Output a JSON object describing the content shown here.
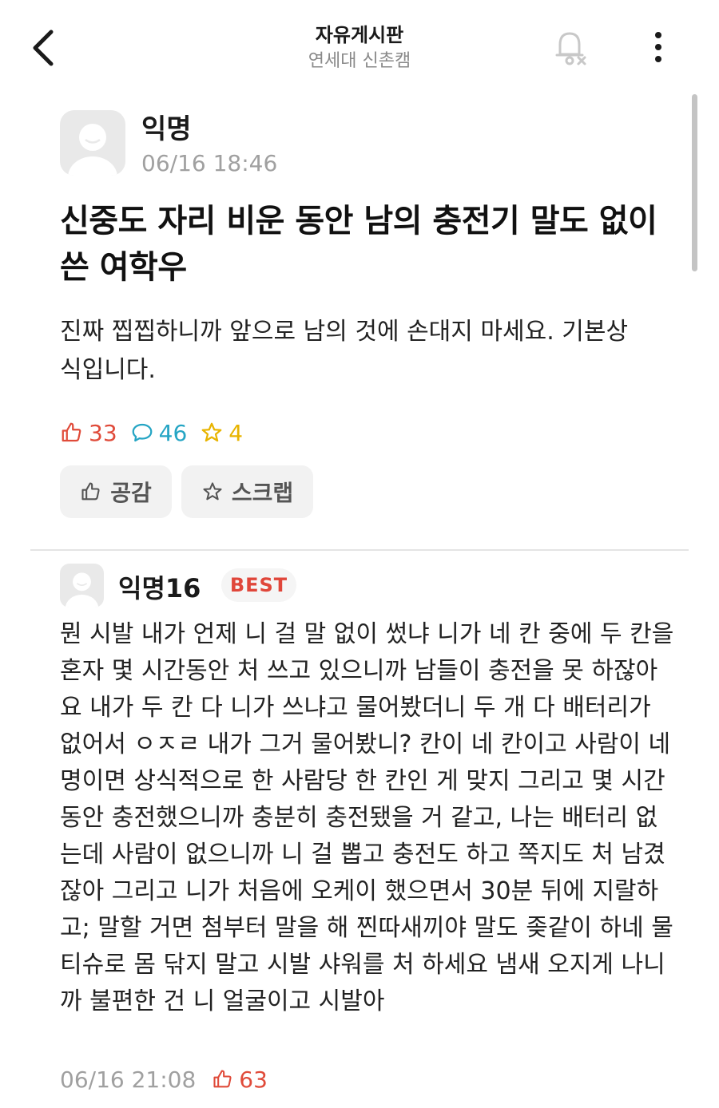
{
  "header": {
    "board_title": "자유게시판",
    "board_subtitle": "연세대 신촌캠"
  },
  "post": {
    "author": "익명",
    "time": "06/16 18:46",
    "title": "신중도 자리 비운 동안 남의 충전기 말도 없이 쓴 여학우",
    "body": "진짜 찝찝하니까 앞으로 남의 것에 손대지 마세요. 기본상식입니다.",
    "likes": "33",
    "comments": "46",
    "scraps": "4",
    "like_button": "공감",
    "scrap_button": "스크랩"
  },
  "comment": {
    "author": "익명16",
    "badge": "BEST",
    "body": "뭔 시발 내가 언제 니 걸 말 없이 썼냐 니가 네 칸 중에 두 칸을 혼자 몇 시간동안 처 쓰고 있으니까 남들이 충전을 못 하잖아요 내가 두 칸 다 니가 쓰냐고 물어봤더니 두 개 다 배터리가 없어서 ㅇㅈㄹ 내가 그거 물어봤니? 칸이 네 칸이고 사람이 네 명이면 상식적으로 한 사람당 한 칸인 게 맞지 그리고 몇 시간동안 충전했으니까 충분히 충전됐을 거 같고, 나는 배터리 없는데 사람이 없으니까 니 걸 뽑고 충전도 하고 쪽지도 처 남겼잖아 그리고 니가 처음에 오케이 했으면서 30분 뒤에 지랄하고; 말할 거면 첨부터 말을 해 찐따새끼야 말도 좆같이 하네 물티슈로 몸 닦지 말고 시발 샤워를 처 하세요 냄새 오지게 나니까 불편한 건 니 얼굴이고 시발아",
    "time": "06/16 21:08",
    "likes": "63"
  },
  "colors": {
    "like": "#e04b3a",
    "comment": "#25a5c4",
    "scrap": "#e8b400",
    "muted": "#a0a0a0"
  },
  "icons": [
    "back-arrow-icon",
    "bell-off-icon",
    "more-vertical-icon",
    "thumbs-up-icon",
    "speech-bubble-icon",
    "star-icon",
    "default-avatar-icon"
  ]
}
